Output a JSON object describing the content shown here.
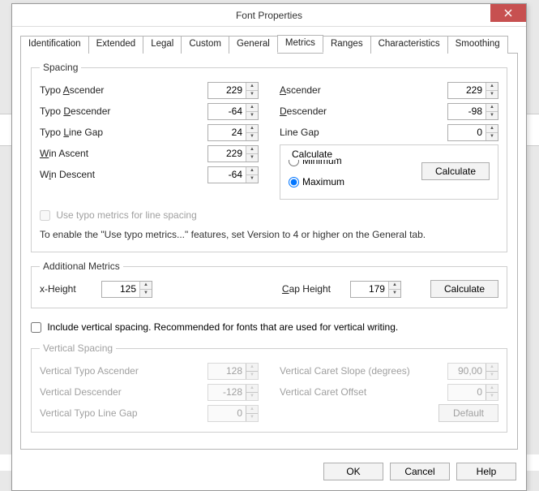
{
  "window": {
    "title": "Font Properties"
  },
  "tabs": {
    "identification": "Identification",
    "extended": "Extended",
    "legal": "Legal",
    "custom": "Custom",
    "general": "General",
    "metrics": "Metrics",
    "ranges": "Ranges",
    "characteristics": "Characteristics",
    "smoothing": "Smoothing"
  },
  "spacing": {
    "legend": "Spacing",
    "typo_ascender_label": "Typo Ascender",
    "typo_ascender_value": "229",
    "typo_descender_label": "Typo Descender",
    "typo_descender_value": "-64",
    "typo_line_gap_label": "Typo Line Gap",
    "typo_line_gap_value": "24",
    "win_ascent_label": "Win Ascent",
    "win_ascent_value": "229",
    "win_descent_label": "Win Descent",
    "win_descent_value": "-64",
    "ascender_label": "Ascender",
    "ascender_value": "229",
    "descender_label": "Descender",
    "descender_value": "-98",
    "line_gap_label": "Line Gap",
    "line_gap_value": "0",
    "calculate_legend": "Calculate",
    "minimum_label": "Minimum",
    "maximum_label": "Maximum",
    "calculate_btn": "Calculate",
    "use_typo_label": "Use typo metrics for line spacing",
    "enable_hint": "To enable the \"Use typo metrics...\" features, set Version to 4 or higher on the General tab."
  },
  "additional": {
    "legend": "Additional Metrics",
    "x_height_label": "x-Height",
    "x_height_value": "125",
    "cap_height_label": "Cap Height",
    "cap_height_value": "179",
    "calculate_btn": "Calculate"
  },
  "include_vertical_label": "Include vertical spacing. Recommended for fonts that are used for vertical writing.",
  "vertical": {
    "legend": "Vertical Spacing",
    "typo_ascender_label": "Vertical Typo Ascender",
    "typo_ascender_value": "128",
    "descender_label": "Vertical Descender",
    "descender_value": "-128",
    "typo_line_gap_label": "Vertical Typo Line Gap",
    "typo_line_gap_value": "0",
    "caret_slope_label": "Vertical Caret Slope (degrees)",
    "caret_slope_value": "90,00",
    "caret_offset_label": "Vertical Caret Offset",
    "caret_offset_value": "0",
    "default_btn": "Default"
  },
  "buttons": {
    "ok": "OK",
    "cancel": "Cancel",
    "help": "Help"
  }
}
